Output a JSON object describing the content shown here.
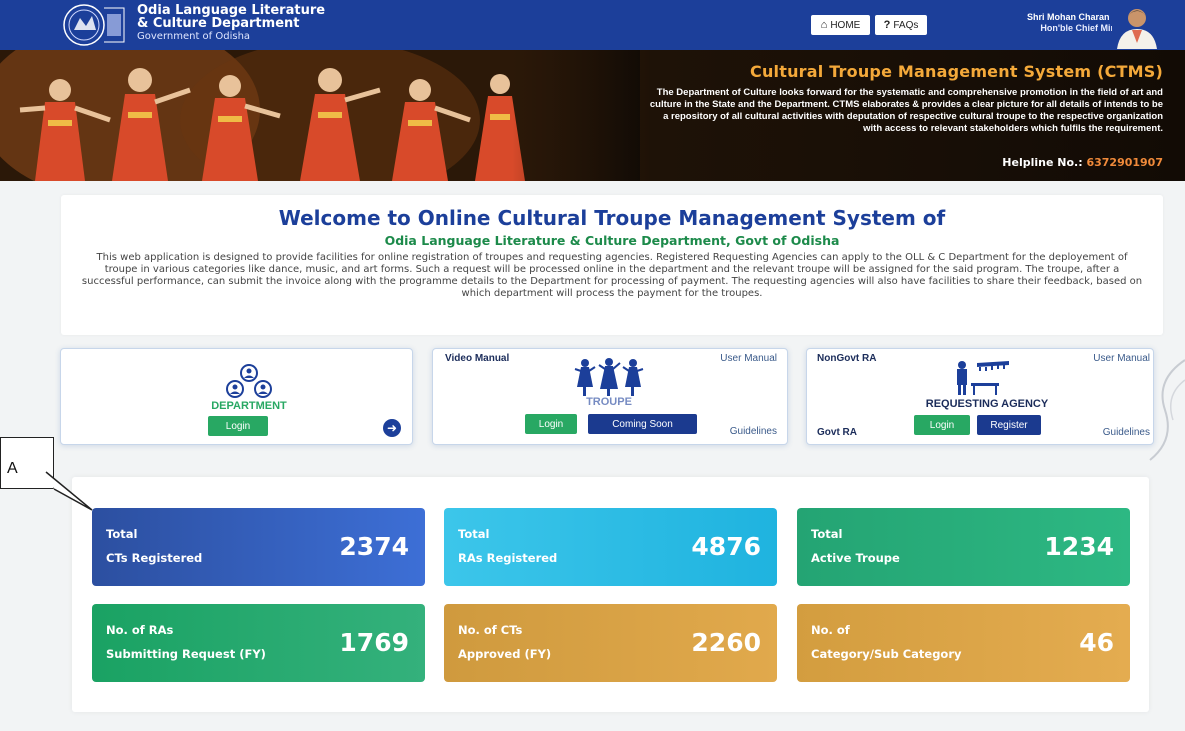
{
  "header": {
    "brand_line1": "Odia Language Literature",
    "brand_line2": "& Culture Department",
    "brand_line3": "Government of Odisha",
    "home_label": "HOME",
    "faq_label": "FAQs",
    "cm_name": "Shri Mohan Charan Majhi",
    "cm_role": "Hon'ble Chief Minister"
  },
  "banner": {
    "title": "Cultural Troupe Management System (CTMS)",
    "description": "The Department of Culture looks forward for the systematic and comprehensive promotion in the field of art and culture in the State and the Department. CTMS elaborates & provides a clear picture for all details of intends to be a repository of all cultural activities with deputation of respective cultural troupe to the respective organization with access to relevant stakeholders which fulfils the requirement.",
    "helpline_label": "Helpline No.:",
    "helpline_number": "6372901907"
  },
  "welcome": {
    "title": "Welcome to Online Cultural Troupe Management System of",
    "subtitle": "Odia Language Literature & Culture Department, Govt of Odisha",
    "body": "This web application is designed to provide facilities for online registration of troupes and requesting agencies. Registered Requesting Agencies can apply to the OLL & C Department for the deployement of troupe in various categories like dance, music, and art forms. Such a request will be processed online in the department and the relevant troupe will be assigned for the said program. The troupe, after a successful performance, can submit the invoice along with the programme details to the Department for processing of payment. The requesting agencies will also have facilities to share their feedback, based on which department will process the payment for the troupes."
  },
  "cards": {
    "department": {
      "name": "DEPARTMENT",
      "login": "Login"
    },
    "troupe": {
      "video_manual": "Video Manual",
      "user_manual": "User Manual",
      "name": "TROUPE",
      "login": "Login",
      "coming_soon": "Coming Soon",
      "guidelines": "Guidelines"
    },
    "ra": {
      "nongovt": "NonGovt RA",
      "user_manual": "User Manual",
      "name": "REQUESTING AGENCY",
      "govt": "Govt RA",
      "login": "Login",
      "register": "Register",
      "guidelines": "Guidelines"
    }
  },
  "stats": [
    {
      "line1": "Total",
      "line2": "CTs Registered",
      "value": "2374"
    },
    {
      "line1": "Total",
      "line2": "RAs Registered",
      "value": "4876"
    },
    {
      "line1": "Total",
      "line2": "Active Troupe",
      "value": "1234"
    },
    {
      "line1": "No. of RAs",
      "line2": "Submitting Request (FY)",
      "value": "1769"
    },
    {
      "line1": "No. of CTs",
      "line2": "Approved (FY)",
      "value": "2260"
    },
    {
      "line1": "No. of",
      "line2": "Category/Sub Category",
      "value": "46"
    }
  ],
  "callout": {
    "label": "A"
  },
  "colors": {
    "primary": "#1c3f9a",
    "green": "#28a863",
    "orange": "#f4a93a"
  }
}
